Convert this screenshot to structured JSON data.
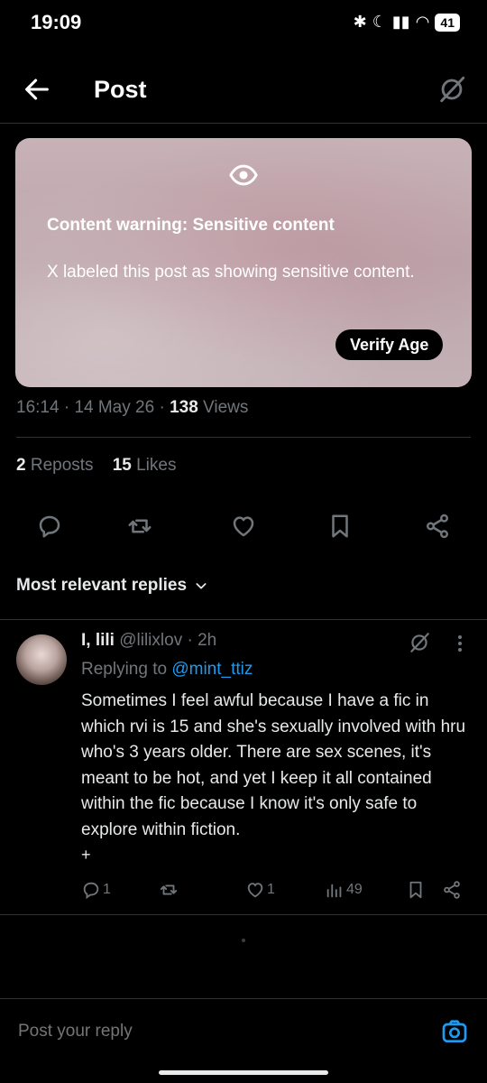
{
  "status_bar": {
    "time": "19:09",
    "battery": "41"
  },
  "header": {
    "title": "Post"
  },
  "content_warning": {
    "title": "Content warning: Sensitive content",
    "body": "X labeled this post as showing sensitive content.",
    "button_label": "Verify Age"
  },
  "post_meta": {
    "time": "16:14",
    "date": "14 May 26",
    "views_count": "138",
    "views_label": "Views"
  },
  "stats": {
    "reposts_count": "2",
    "reposts_label": "Reposts",
    "likes_count": "15",
    "likes_label": "Likes"
  },
  "replies_filter": {
    "label": "Most relevant replies"
  },
  "reply": {
    "name": "I, lili",
    "handle": "@lilixlov",
    "time": "2h",
    "replying_label": "Replying to",
    "replying_mention": "@mint_ttiz",
    "text": "Sometimes I feel awful because I have a fic in which rvi is 15 and she's sexually involved with hru who's 3 years older. There are sex scenes, it's meant to be hot, and yet I keep it all contained within the fic because I know it's only safe to explore within fiction.",
    "show_more": "+",
    "actions": {
      "replies": "1",
      "likes": "1",
      "views": "49"
    }
  },
  "composer": {
    "placeholder": "Post your reply"
  },
  "colors": {
    "accent": "#1d9bf0",
    "muted": "#71767b",
    "background": "#000000"
  }
}
